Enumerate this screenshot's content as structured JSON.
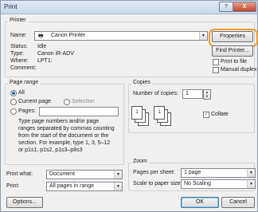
{
  "window": {
    "title": "Print",
    "help": "?",
    "close": "X"
  },
  "printer": {
    "group_label": "Printer",
    "name_label": "Name:",
    "name_value": "Canon Printer",
    "properties_label": "Properties",
    "find_printer_label": "Find Printer...",
    "status_label": "Status:",
    "status_value": "Idle",
    "type_label": "Type:",
    "type_value": "Canon iR-ADV",
    "where_label": "Where:",
    "where_value": "LPT1:",
    "comment_label": "Comment:",
    "print_to_file_label": "Print to file",
    "manual_duplex_label": "Manual duplex"
  },
  "page_range": {
    "group_label": "Page range",
    "all_label": "All",
    "current_page_label": "Current page",
    "selection_label": "Selection",
    "pages_label": "Pages:",
    "pages_value": "",
    "hint_lines": [
      "Type page numbers and/or page",
      "ranges separated by commas counting",
      "from the start of the document or the",
      "section. For example, type 1, 3, 5–12",
      "or p1s1, p1s2, p1s3–p8s3"
    ]
  },
  "copies": {
    "group_label": "Copies",
    "number_label": "Number of copies:",
    "number_value": "1",
    "collate_label": "Collate",
    "collate_checked": true,
    "page_glyphs": [
      "1",
      "2",
      "3",
      "1",
      "2",
      "3"
    ]
  },
  "print_options": {
    "print_what_label": "Print what:",
    "print_what_value": "Document",
    "print_label": "Print:",
    "print_value": "All pages in range"
  },
  "zoom": {
    "group_label": "Zoom",
    "pages_per_sheet_label": "Pages per sheet:",
    "pages_per_sheet_value": "1 page",
    "scale_label": "Scale to paper size:",
    "scale_value": "No Scaling"
  },
  "footer": {
    "options_label": "Options...",
    "ok_label": "OK",
    "cancel_label": "Cancel"
  },
  "colors": {
    "highlight": "#f29a2e",
    "accent": "#2a6fc9"
  }
}
